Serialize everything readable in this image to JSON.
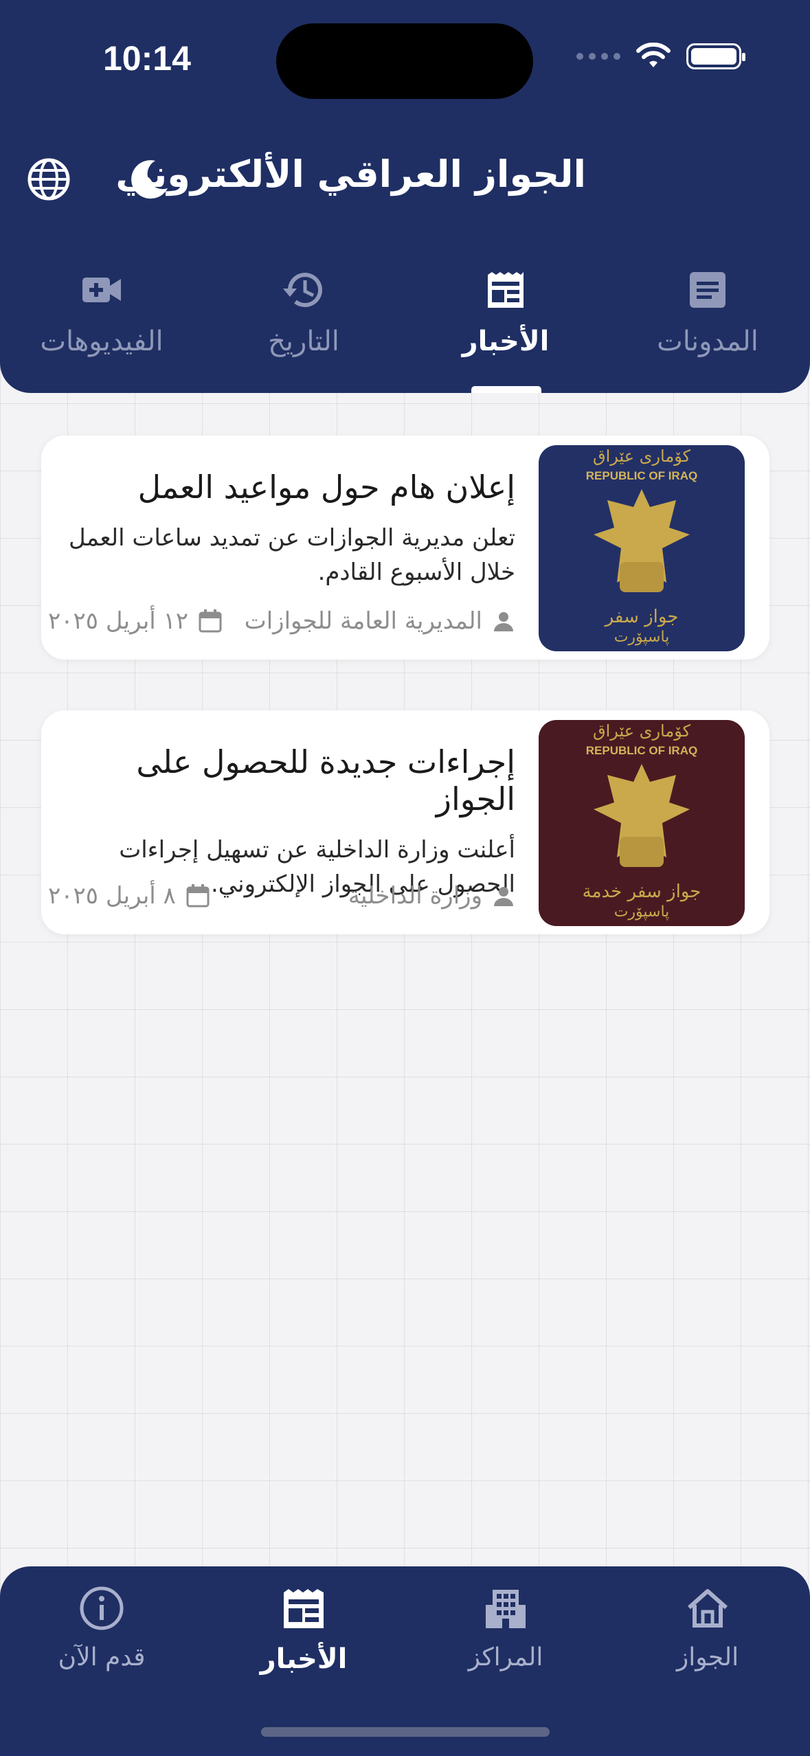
{
  "status_bar": {
    "time": "10:14"
  },
  "header": {
    "title": "الجواز العراقي الألكتروني"
  },
  "tabs": [
    {
      "label": "المدونات",
      "icon": "article-icon",
      "active": false
    },
    {
      "label": "الأخبار",
      "icon": "newspaper-icon",
      "active": true
    },
    {
      "label": "التاريخ",
      "icon": "history-icon",
      "active": false
    },
    {
      "label": "الفيديوهات",
      "icon": "video-add-icon",
      "active": false
    }
  ],
  "news": [
    {
      "title": "إعلان هام حول مواعيد العمل",
      "description": "تعلن مديرية الجوازات عن تمديد ساعات العمل خلال الأسبوع القادم.",
      "author": "المديرية العامة للجوازات",
      "date": "١٢ أبريل ٢٠٢٥",
      "image": {
        "caption_top": "REPUBLIC OF IRAQ",
        "color": "#233066"
      }
    },
    {
      "title": "إجراءات جديدة للحصول على الجواز",
      "description": "أعلنت وزارة الداخلية عن تسهيل إجراءات الحصول على الجواز الإلكتروني.",
      "author": "وزارة الداخلية",
      "date": "٨ أبريل ٢٠٢٥",
      "image": {
        "caption_top": "REPUBLIC OF IRAQ",
        "color": "#4a1a22"
      }
    }
  ],
  "bottom_nav": [
    {
      "label": "الجواز",
      "icon": "home-icon",
      "active": false
    },
    {
      "label": "المراكز",
      "icon": "building-icon",
      "active": false
    },
    {
      "label": "الأخبار",
      "icon": "newspaper-icon",
      "active": true
    },
    {
      "label": "قدم الآن",
      "icon": "info-icon",
      "active": false
    }
  ],
  "colors": {
    "primary": "#1f2f63",
    "inactive": "#8f98b8"
  }
}
